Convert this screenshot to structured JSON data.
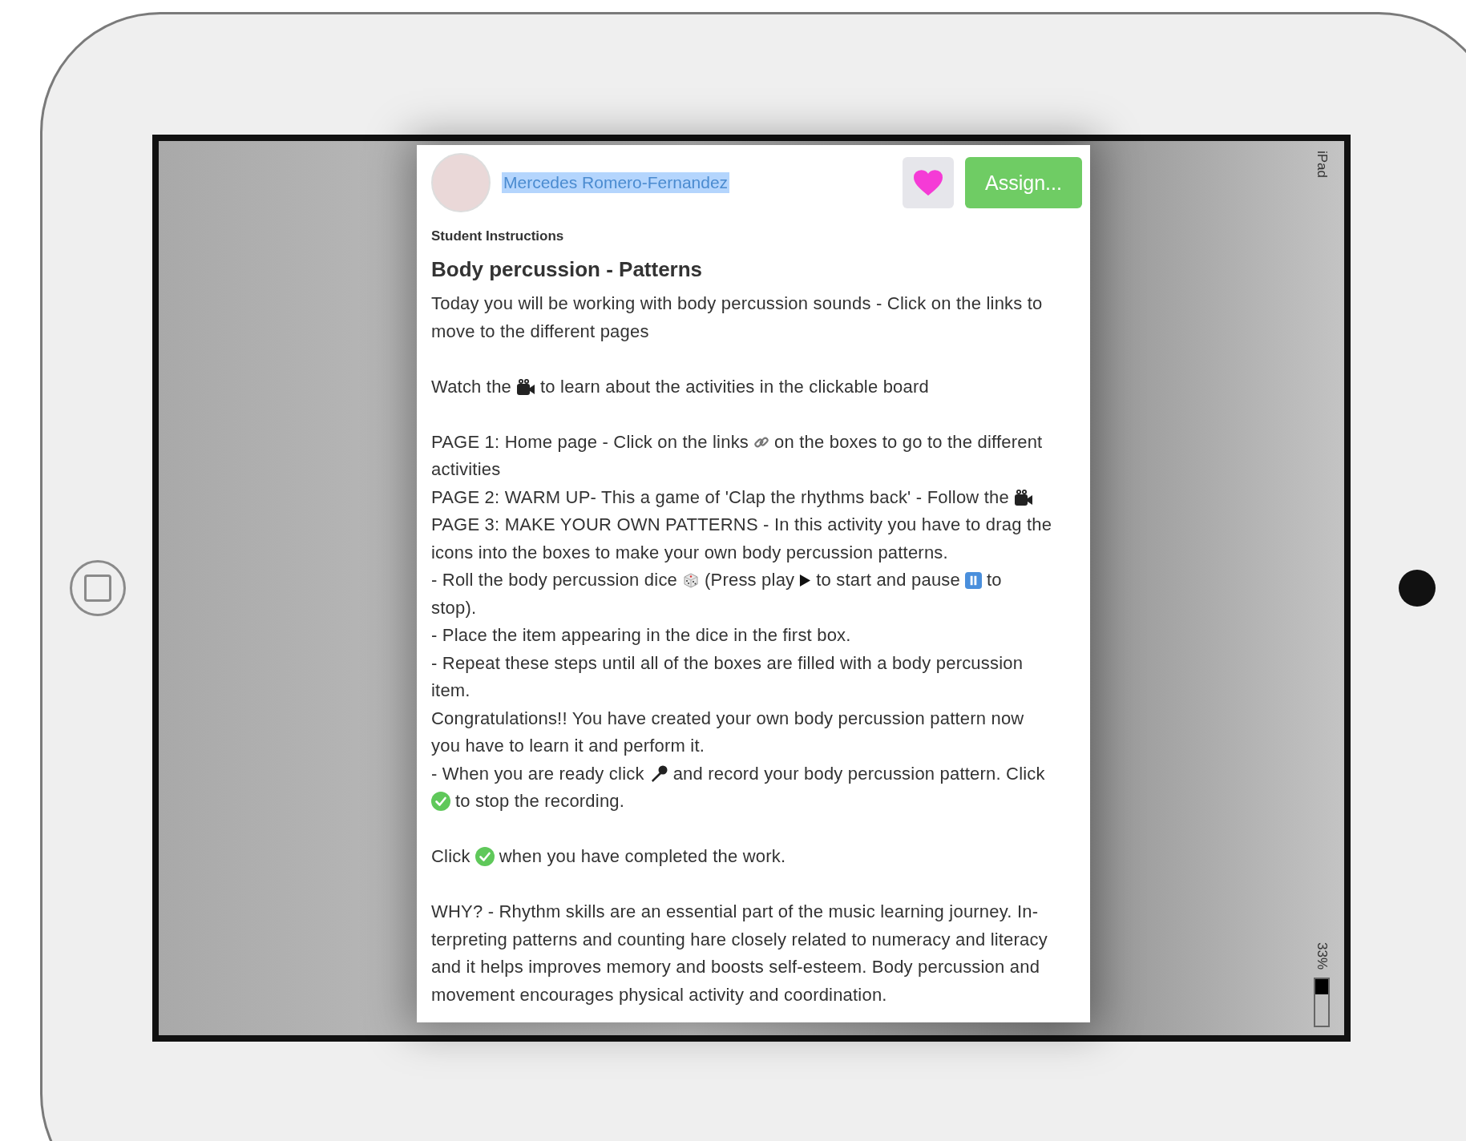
{
  "author": {
    "name": "Mercedes Romero-Fernandez",
    "highlighted": true
  },
  "like": {
    "liked": true
  },
  "assign_button": "Assign...",
  "section_label": "Student Instructions",
  "title": "Body percussion - Patterns",
  "blocks": [
    {
      "lines": [
        {
          "parts": [
            {
              "kind": "text",
              "text": "Today you will be working with body percussion sounds - Click on the links to"
            }
          ]
        },
        {
          "parts": [
            {
              "kind": "text",
              "text": "move to the different pages"
            }
          ]
        }
      ]
    },
    {
      "lines": [
        {
          "parts": [
            {
              "kind": "text",
              "text": "Watch the"
            },
            {
              "kind": "camera"
            },
            {
              "kind": "text",
              "text": "to learn about the activities in the clickable board"
            }
          ]
        }
      ]
    },
    {
      "lines": [
        {
          "parts": [
            {
              "kind": "text",
              "text": "PAGE 1: Home page - Click on the links"
            },
            {
              "kind": "link"
            },
            {
              "kind": "text",
              "text": "on the boxes to go to the different"
            }
          ]
        },
        {
          "parts": [
            {
              "kind": "text",
              "text": "activities"
            }
          ]
        },
        {
          "parts": [
            {
              "kind": "text",
              "text": "PAGE 2: WARM UP- This a game of 'Clap the rhythms back' - Follow the"
            },
            {
              "kind": "camera"
            }
          ]
        },
        {
          "parts": [
            {
              "kind": "text",
              "text": "PAGE 3: MAKE YOUR OWN PATTERNS - In this activity you have to drag the"
            }
          ]
        },
        {
          "parts": [
            {
              "kind": "text",
              "text": "icons into the boxes to make your own body percussion patterns."
            }
          ]
        },
        {
          "parts": [
            {
              "kind": "text",
              "text": "- Roll the body percussion dice"
            },
            {
              "kind": "dice"
            },
            {
              "kind": "text",
              "text": "(Press play"
            },
            {
              "kind": "play"
            },
            {
              "kind": "text",
              "text": "to start and pause"
            },
            {
              "kind": "pause"
            },
            {
              "kind": "text",
              "text": "to"
            }
          ]
        },
        {
          "parts": [
            {
              "kind": "text",
              "text": "stop)."
            }
          ]
        },
        {
          "parts": [
            {
              "kind": "text",
              "text": "- Place the item appearing in the dice in the first box."
            }
          ]
        },
        {
          "parts": [
            {
              "kind": "text",
              "text": "- Repeat these steps until all of the boxes are filled with a body percussion"
            }
          ]
        },
        {
          "parts": [
            {
              "kind": "text",
              "text": "item."
            }
          ]
        },
        {
          "parts": [
            {
              "kind": "text",
              "text": "Congratulations!! You have created your own body percussion pattern now"
            }
          ]
        },
        {
          "parts": [
            {
              "kind": "text",
              "text": "you have to learn it and perform it."
            }
          ]
        },
        {
          "parts": [
            {
              "kind": "text",
              "text": "- When you are ready click"
            },
            {
              "kind": "mic"
            },
            {
              "kind": "text",
              "text": "and record your body percussion pattern. Click"
            }
          ]
        },
        {
          "parts": [
            {
              "kind": "check"
            },
            {
              "kind": "text",
              "text": "to stop the recording."
            }
          ]
        }
      ]
    },
    {
      "lines": [
        {
          "parts": [
            {
              "kind": "text",
              "text": "Click"
            },
            {
              "kind": "check"
            },
            {
              "kind": "text",
              "text": "when you have completed the work."
            }
          ]
        }
      ]
    },
    {
      "lines": [
        {
          "parts": [
            {
              "kind": "text",
              "text": "WHY? - Rhythm skills are an essential part of the music learning journey. In-"
            }
          ]
        },
        {
          "parts": [
            {
              "kind": "text",
              "text": "terpreting patterns and counting hare closely related to numeracy and literacy"
            }
          ]
        },
        {
          "parts": [
            {
              "kind": "text",
              "text": "and it helps improves memory and boosts self-esteem. Body percussion and"
            }
          ]
        },
        {
          "parts": [
            {
              "kind": "text",
              "text": "movement encourages physical activity and coordination."
            }
          ]
        }
      ]
    }
  ],
  "status": {
    "device_label": "iPad",
    "battery": {
      "reading": "33%",
      "level": 0.33
    }
  }
}
